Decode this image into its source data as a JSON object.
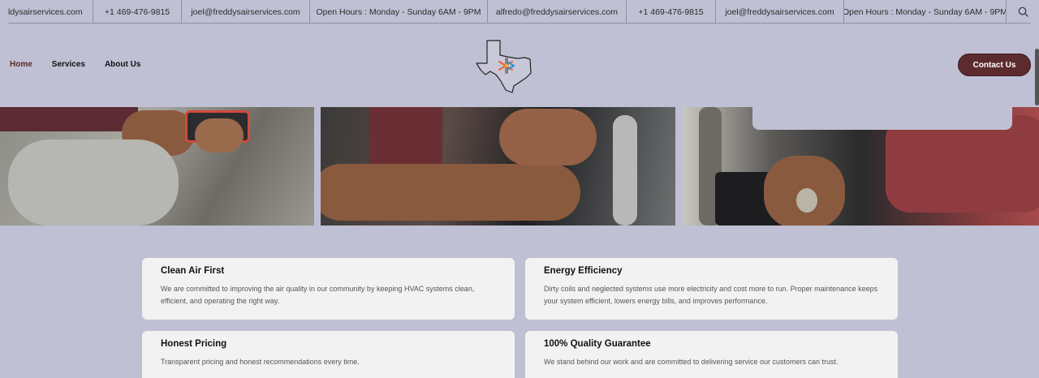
{
  "topbar": {
    "items": [
      "ldysairservices.com",
      "+1 469-476-9815",
      "joel@freddysairservices.com",
      "Open Hours : Monday - Sunday 6AM - 9PM",
      "alfredo@freddysairservices.com",
      "+1 469-476-9815",
      "joel@freddysairservices.com",
      "Open Hours : Monday - Sunday 6AM - 9PM"
    ],
    "search_icon": "search-icon"
  },
  "nav": {
    "items": [
      "Home",
      "Services",
      "About Us"
    ],
    "active": "Home"
  },
  "header": {
    "logo_icon": "texas-snowflake-logo",
    "contact_label": "Contact Us"
  },
  "colors": {
    "background": "#bfc0d3",
    "accent": "#5c2b2e",
    "card": "#f2f2f2"
  },
  "values": {
    "cards": [
      {
        "title": "Clean Air First",
        "text": "We are committed to improving the air quality in our community by keeping HVAC systems clean, efficient, and operating the right way."
      },
      {
        "title": "Energy Efficiency",
        "text": "Dirty coils and neglected systems use more electricity and cost more to run. Proper maintenance keeps your system efficient, lowers energy bills, and improves performance."
      },
      {
        "title": "Honest Pricing",
        "text": "Transparent pricing and honest recommendations every time."
      },
      {
        "title": "100% Quality Guarantee",
        "text": "We stand behind our work and are committed to delivering service our customers can trust."
      }
    ]
  }
}
